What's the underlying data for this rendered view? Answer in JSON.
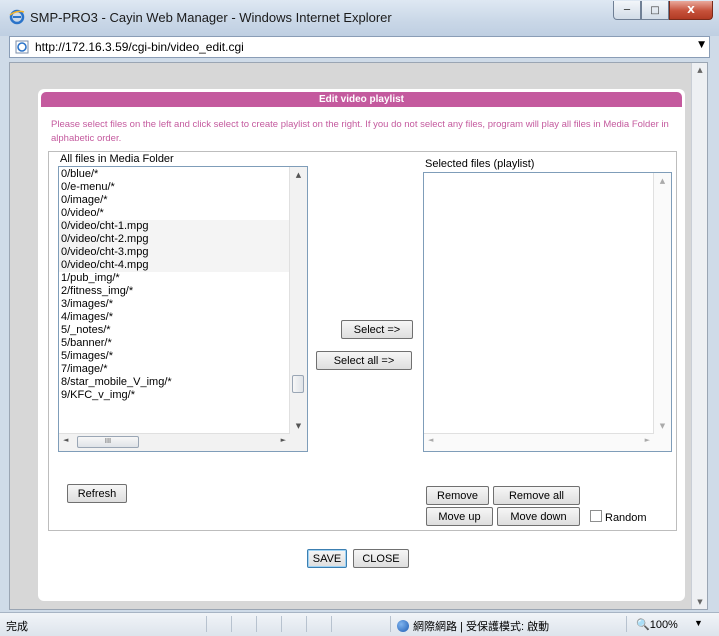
{
  "window": {
    "title": "SMP-PRO3 - Cayin Web Manager - Windows Internet Explorer",
    "minimize": "─",
    "maximize": "□",
    "close": "X"
  },
  "address": {
    "url": "http://172.16.3.59/cgi-bin/video_edit.cgi"
  },
  "dialog": {
    "title": "Edit video playlist",
    "instructions": "Please select files on the left and click select to create playlist on the right. If you do not select any files, program will play all files in Media Folder in alphabetic order.",
    "all_files_label": "All files in Media Folder",
    "selected_label": "Selected files (playlist)",
    "media_files": [
      "0/blue/*",
      "0/e-menu/*",
      "0/image/*",
      "0/video/*",
      "0/video/cht-1.mpg",
      "0/video/cht-2.mpg",
      "0/video/cht-3.mpg",
      "0/video/cht-4.mpg",
      "1/pub_img/*",
      "2/fitness_img/*",
      "3/images/*",
      "4/images/*",
      "5/_notes/*",
      "5/banner/*",
      "5/images/*",
      "7/image/*",
      "8/star_mobile_V_img/*",
      "9/KFC_v_img/*"
    ],
    "refresh": "Refresh",
    "select": "Select =>",
    "select_all": "Select all =>",
    "remove": "Remove",
    "remove_all": "Remove all",
    "move_up": "Move up",
    "move_down": "Move down",
    "random": "Random",
    "save": "SAVE",
    "close": "CLOSE",
    "h_thumb_glyph": "III"
  },
  "status": {
    "done": "完成",
    "zone": "網際網路 | 受保護模式: 啟動",
    "zoom": "100%"
  }
}
